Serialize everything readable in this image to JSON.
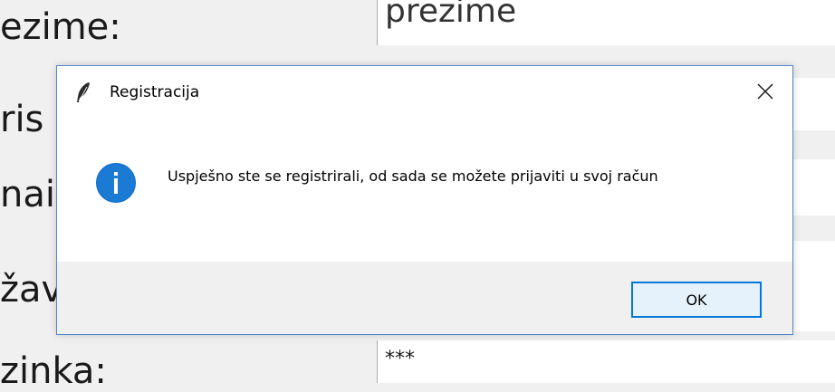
{
  "background": {
    "labels": [
      "ezime:",
      "ris",
      "nai",
      "žav",
      "zinka:"
    ],
    "entries": [
      "prezime",
      "***"
    ]
  },
  "dialog": {
    "title": "Registracija",
    "title_icon": "feather-icon",
    "close_icon": "close-icon",
    "info_icon": "info-icon",
    "message": "Uspješno ste se registrirali, od sada se možete prijaviti u svoj račun",
    "ok_label": "OK",
    "accent_color": "#0078d7",
    "info_color": "#0a6cc9"
  }
}
